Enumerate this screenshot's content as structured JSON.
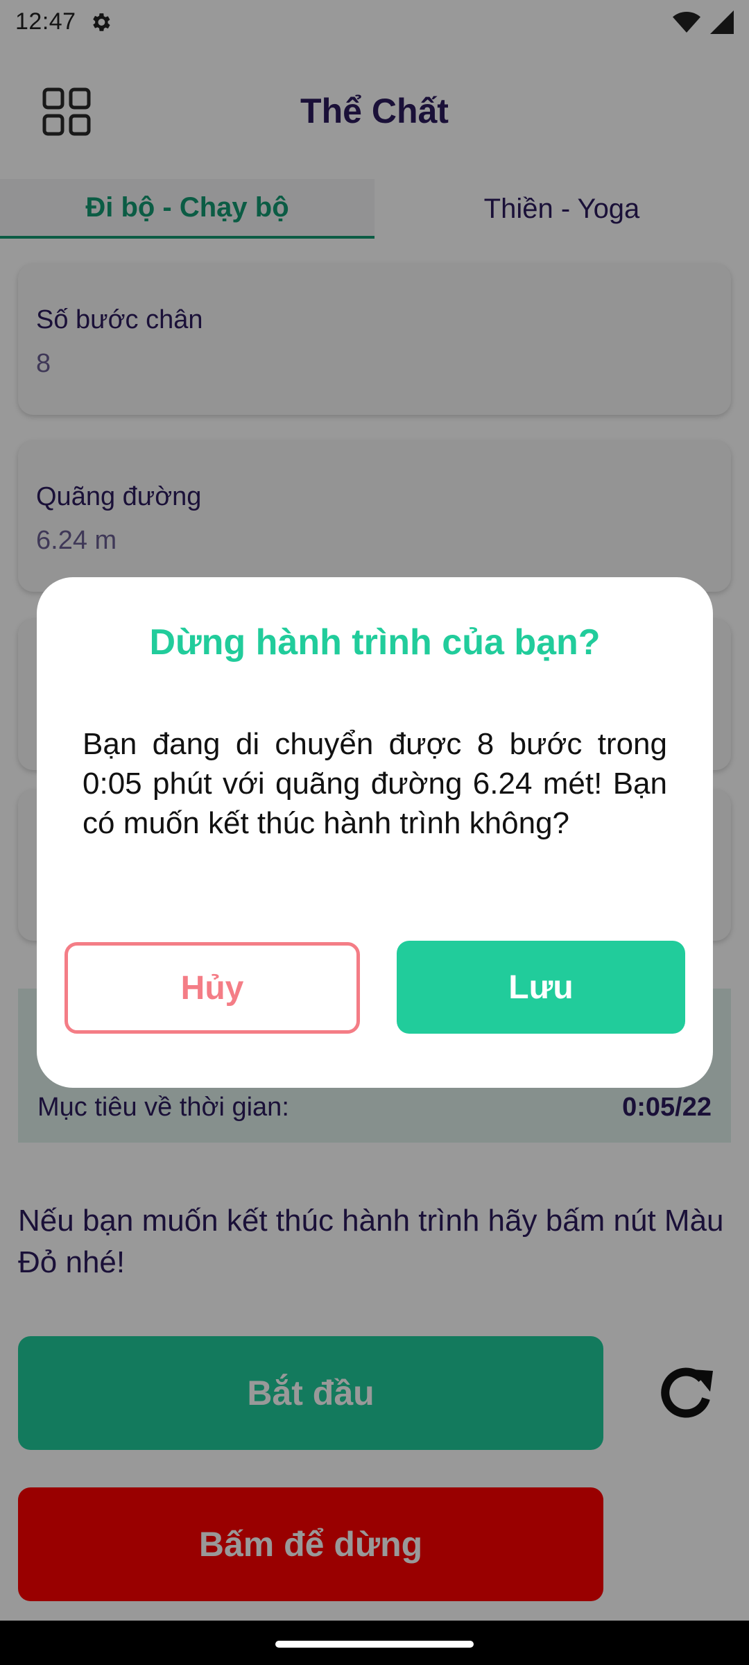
{
  "status_bar": {
    "time": "12:47",
    "settings_icon": "gear-icon",
    "wifi_icon": "wifi-icon",
    "signal_icon": "signal-icon"
  },
  "header": {
    "title": "Thể Chất",
    "menu_icon": "grid-icon"
  },
  "tabs": [
    {
      "label": "Đi bộ - Chạy bộ",
      "active": true
    },
    {
      "label": "Thiền - Yoga",
      "active": false
    }
  ],
  "cards": [
    {
      "label": "Số bước chân",
      "value": "8"
    },
    {
      "label": "Quãng đường",
      "value": "6.24 m"
    }
  ],
  "goal": {
    "time_label": "Mục tiêu về thời gian:",
    "time_value": "0:05/22"
  },
  "hint": "Nếu bạn muốn kết thúc hành trình hãy bấm nút Màu Đỏ nhé!",
  "buttons": {
    "start_label": "Bắt đầu",
    "stop_label": "Bấm để dừng",
    "refresh_icon": "refresh-icon"
  },
  "dialog": {
    "title": "Dừng hành trình của bạn?",
    "message": "Bạn đang di chuyển được 8 bước trong 0:05 phút với quãng đường 6.24 mét! Bạn có muốn kết thúc hành trình không?",
    "cancel_label": "Hủy",
    "save_label": "Lưu"
  },
  "colors": {
    "accent": "#21cc9b",
    "title_text": "#2c1b5e",
    "stop_red": "#ff0000",
    "cancel_pink": "#f47d86"
  }
}
